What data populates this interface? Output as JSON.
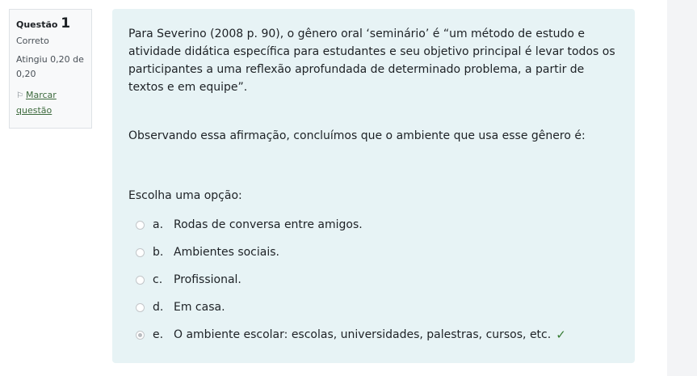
{
  "info": {
    "question_label": "Questão",
    "question_number": "1",
    "state": "Correto",
    "grade": "Atingiu 0,20 de 0,20",
    "flag_text": "Marcar questão",
    "flag_icon": "flag-icon"
  },
  "question": {
    "paragraph1": "Para Severino (2008 p. 90), o gênero oral ‘seminário’ é “um método de estudo e atividade didática específica para estudantes e seu objetivo principal é levar todos os participantes a uma reflexão aprofundada de determinado problema, a partir de textos e em equipe”.",
    "paragraph2": "Observando essa afirmação, concluímos que o ambiente que usa esse gênero é:",
    "prompt": "Escolha uma opção:",
    "options": [
      {
        "letter": "a.",
        "text": "Rodas de conversa entre amigos."
      },
      {
        "letter": "b.",
        "text": "Ambientes sociais."
      },
      {
        "letter": "c.",
        "text": "Profissional."
      },
      {
        "letter": "d.",
        "text": "Em casa."
      },
      {
        "letter": "e.",
        "text": "O ambiente escolar: escolas, universidades, palestras, cursos, etc."
      }
    ],
    "selected_option": "e.",
    "correct_mark": "✓"
  },
  "colors": {
    "formulation_bg": "#e7f3f5",
    "correct_green": "#357a32",
    "drawer_bg": "#f3f4f6"
  }
}
